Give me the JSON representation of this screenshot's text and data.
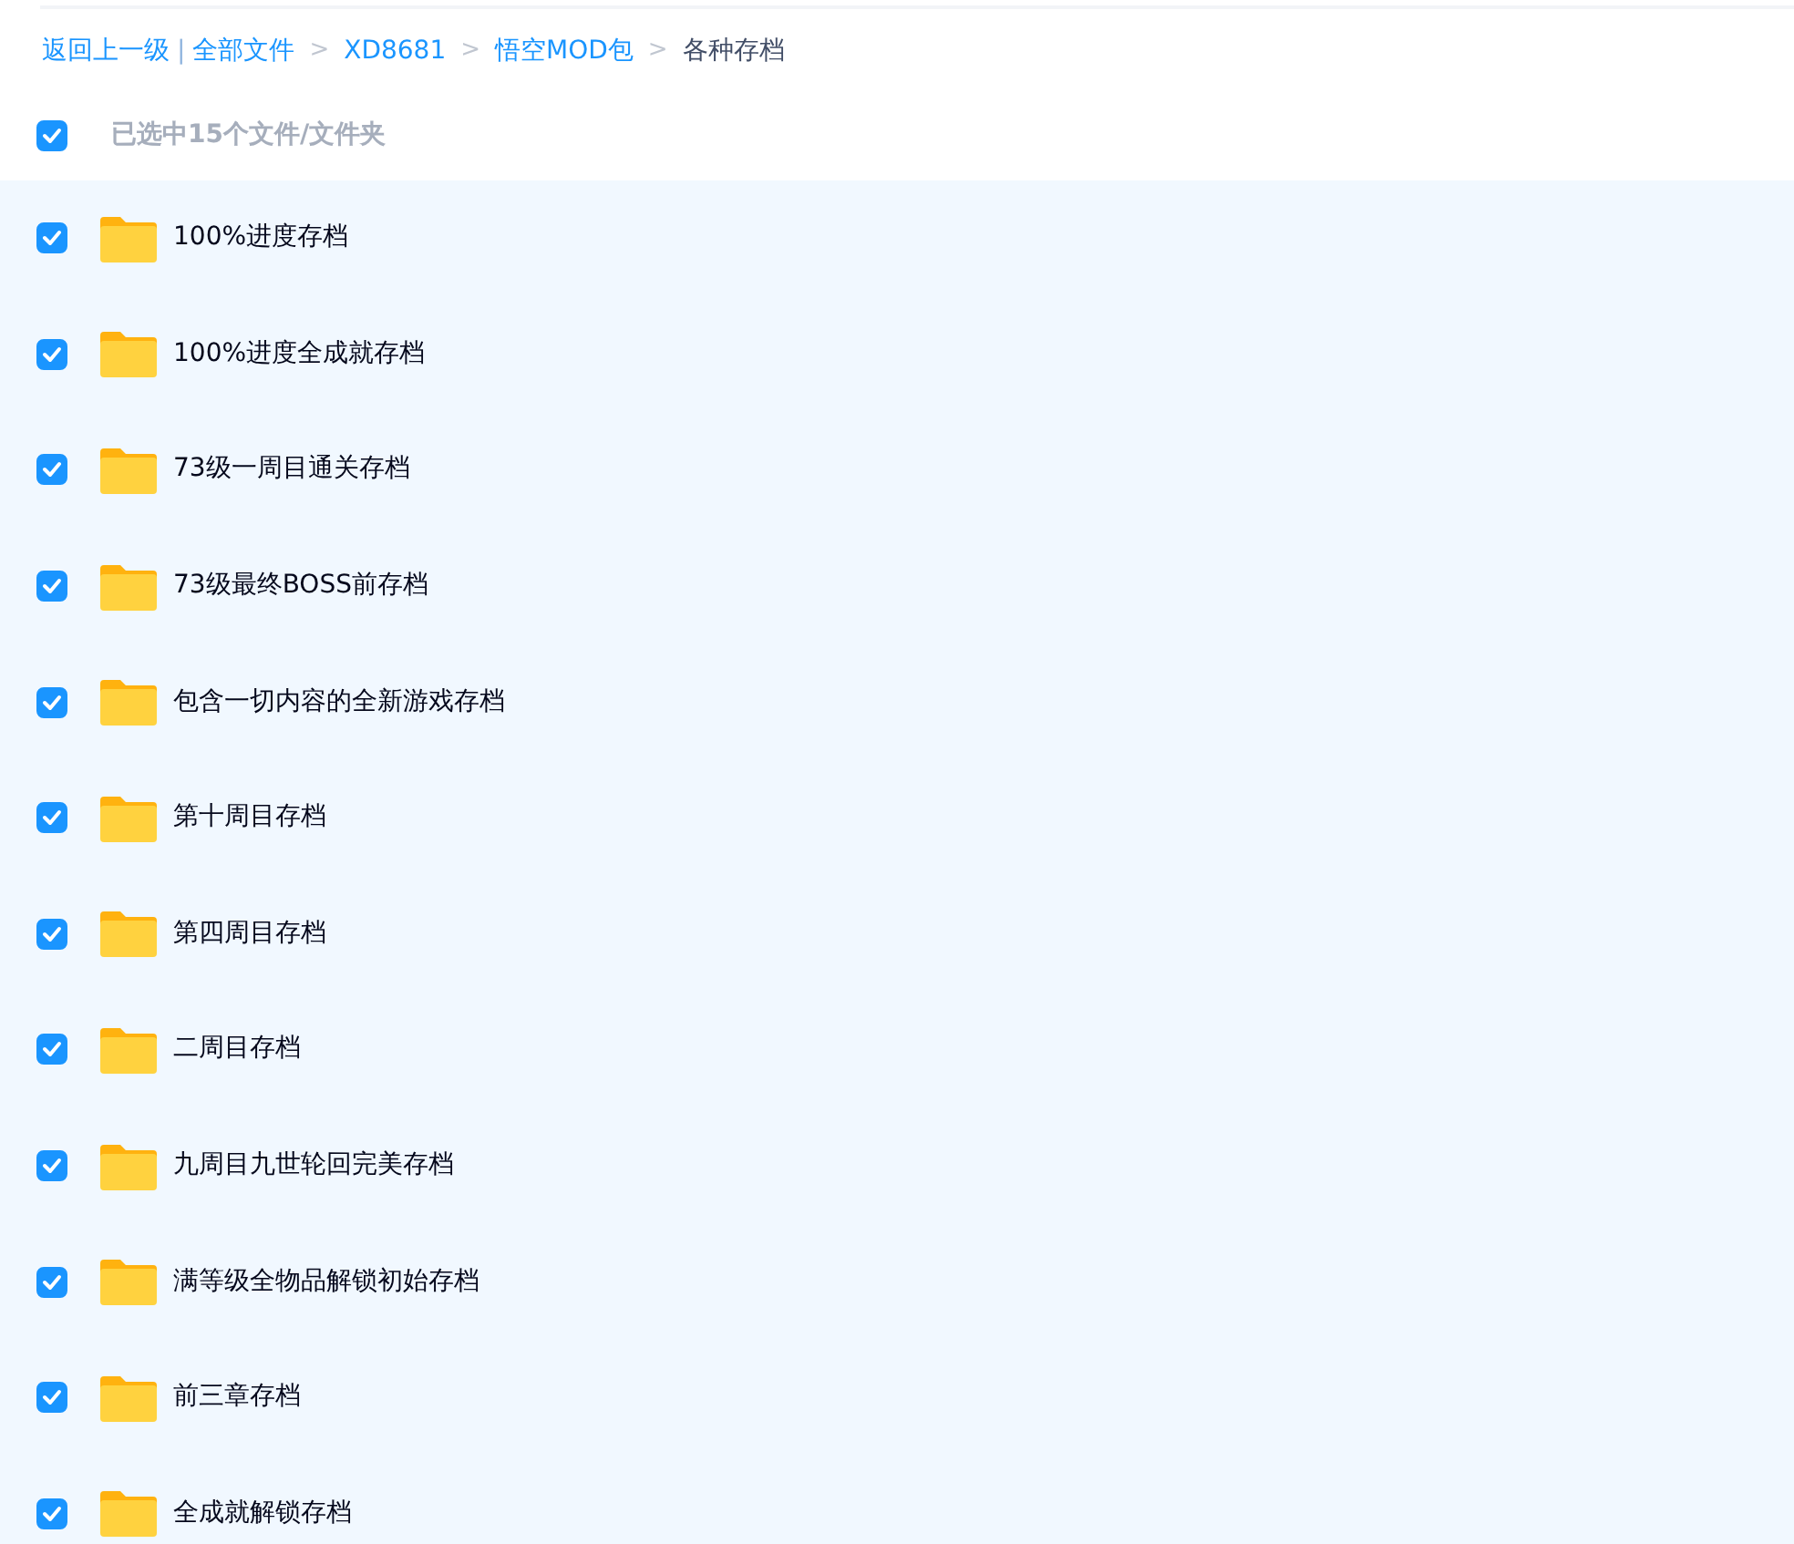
{
  "breadcrumb": {
    "back": "返回上一级",
    "separator": "|",
    "items": [
      {
        "label": "全部文件",
        "current": false
      },
      {
        "label": "XD8681",
        "current": false
      },
      {
        "label": "悟空MOD包",
        "current": false
      },
      {
        "label": "各种存档",
        "current": true
      }
    ],
    "arrow": ">"
  },
  "selection": {
    "checked": true,
    "label": "已选中15个文件/文件夹"
  },
  "files": [
    {
      "name": "100%进度存档",
      "checked": true
    },
    {
      "name": "100%进度全成就存档",
      "checked": true
    },
    {
      "name": "73级一周目通关存档",
      "checked": true
    },
    {
      "name": "73级最终BOSS前存档",
      "checked": true
    },
    {
      "name": "包含一切内容的全新游戏存档",
      "checked": true
    },
    {
      "name": "第十周目存档",
      "checked": true
    },
    {
      "name": "第四周目存档",
      "checked": true
    },
    {
      "name": "二周目存档",
      "checked": true
    },
    {
      "name": "九周目九世轮回完美存档",
      "checked": true
    },
    {
      "name": "满等级全物品解锁初始存档",
      "checked": true
    },
    {
      "name": "前三章存档",
      "checked": true
    },
    {
      "name": "全成就解锁存档",
      "checked": true
    }
  ]
}
